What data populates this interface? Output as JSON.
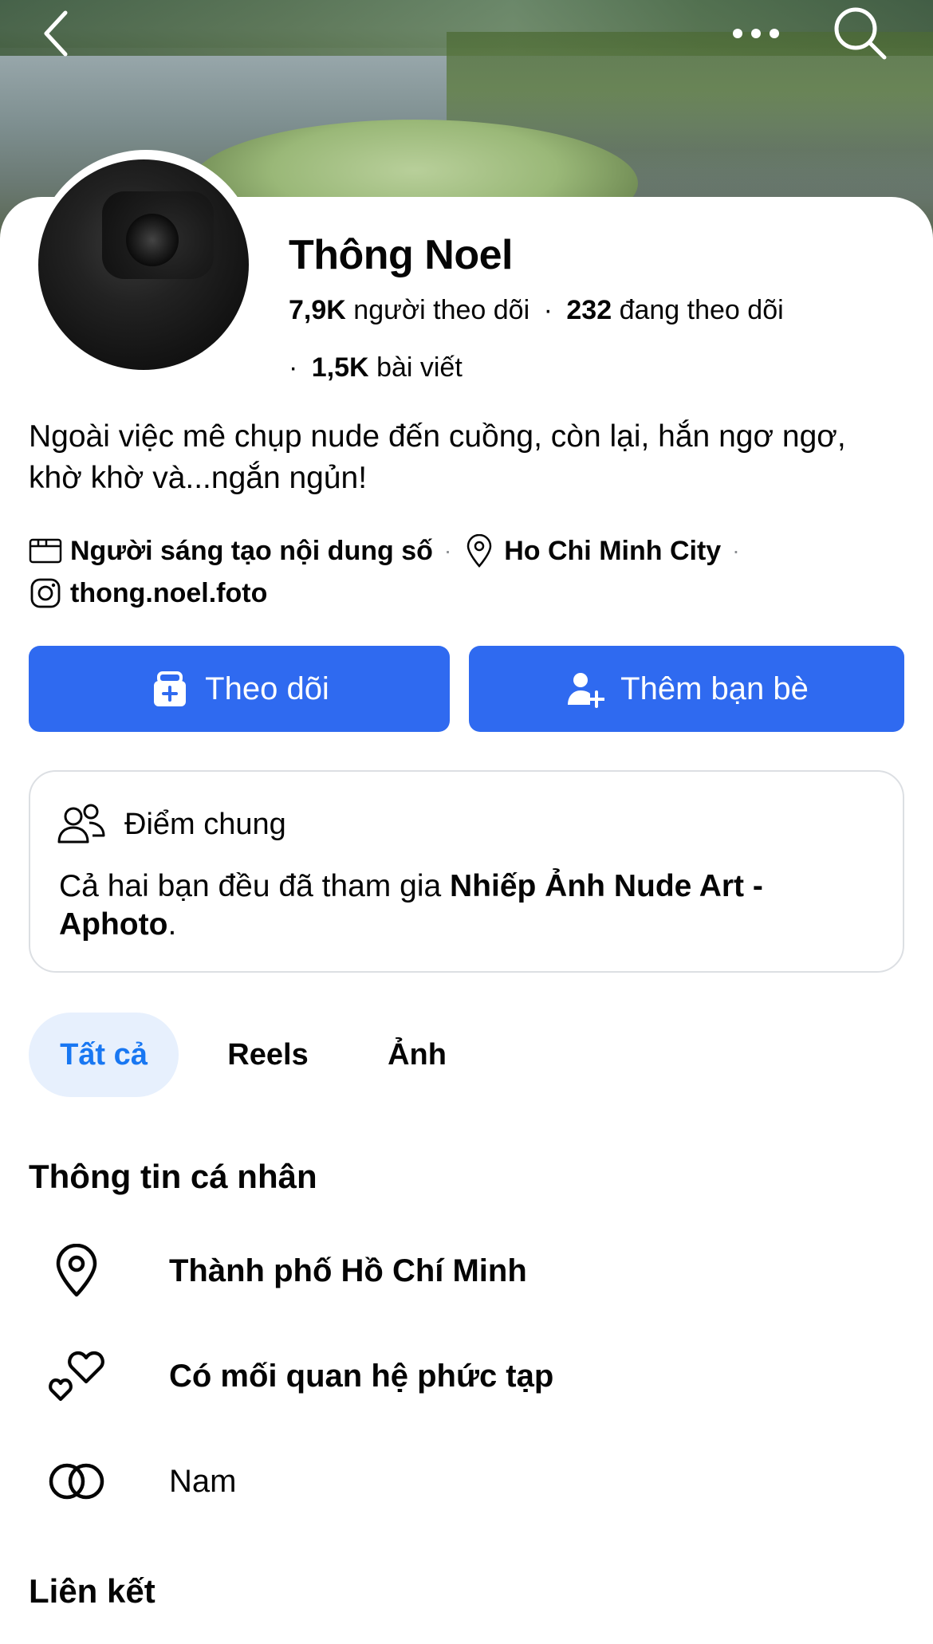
{
  "topbar": {
    "back_icon": "chevron-left-icon",
    "more_icon": "more-horizontal-icon",
    "search_icon": "search-icon"
  },
  "profile": {
    "name": "Thông Noel",
    "followers_count": "7,9K",
    "followers_label": "người theo dõi",
    "following_count": "232",
    "following_label": "đang theo dõi",
    "posts_count": "1,5K",
    "posts_label": "bài viết",
    "separator": "·",
    "bio": "Ngoài việc mê chụp nude đến cuồng, còn lại, hắn ngơ ngơ, khờ khờ và...ngắn ngủn!",
    "category": "Người sáng tạo nội dung số",
    "location": "Ho Chi Minh City",
    "instagram": "thong.noel.foto"
  },
  "actions": {
    "follow_label": "Theo dõi",
    "add_friend_label": "Thêm bạn bè",
    "accent_color": "#2f6af0"
  },
  "common": {
    "title": "Điểm chung",
    "text_prefix": "Cả hai bạn đều đã tham gia ",
    "group_name": "Nhiếp Ảnh Nude Art - Aphoto",
    "text_suffix": "."
  },
  "tabs": [
    {
      "label": "Tất cả",
      "active": true
    },
    {
      "label": "Reels",
      "active": false
    },
    {
      "label": "Ảnh",
      "active": false
    }
  ],
  "personal_info": {
    "title": "Thông tin cá nhân",
    "items": [
      {
        "icon": "location-pin-icon",
        "text": "Thành phố Hồ Chí Minh"
      },
      {
        "icon": "hearts-icon",
        "text": "Có mối quan hệ phức tạp"
      },
      {
        "icon": "gender-rings-icon",
        "text": "Nam"
      }
    ]
  },
  "links": {
    "title": "Liên kết"
  }
}
